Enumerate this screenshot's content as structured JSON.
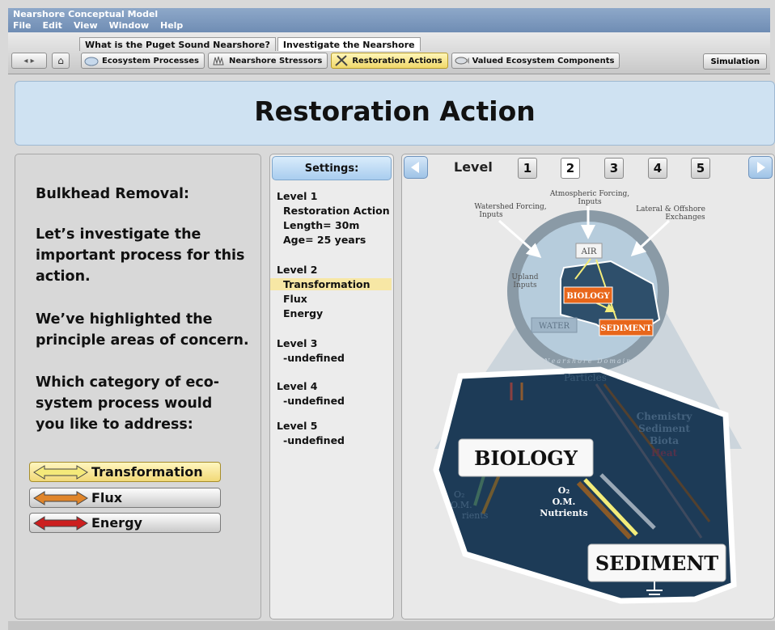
{
  "app": {
    "title": "Nearshore Conceptual Model"
  },
  "menu": [
    "File",
    "Edit",
    "View",
    "Window",
    "Help"
  ],
  "tabs": [
    {
      "label": "What is the Puget Sound Nearshore?"
    },
    {
      "label": "Investigate the Nearshore"
    }
  ],
  "subtabs": [
    {
      "label": "Ecosystem Processes",
      "icon": "ecosystem-icon"
    },
    {
      "label": "Nearshore Stressors",
      "icon": "hand-icon"
    },
    {
      "label": "Restoration Actions",
      "icon": "tools-icon"
    },
    {
      "label": "Valued Ecosystem Components",
      "icon": "fish-icon"
    }
  ],
  "toolbar": {
    "simulation": "Simulation"
  },
  "header": {
    "title": "Restoration Action"
  },
  "left": {
    "heading": "Bulkhead Removal:",
    "p1": [
      "Let’s investigate the",
      "important process for this",
      "action."
    ],
    "p2": [
      "We’ve highlighted the",
      "principle areas of concern."
    ],
    "p3": [
      "Which category of eco-",
      "system process would",
      "you like to address:"
    ],
    "buttons": [
      {
        "label": "Transformation",
        "color": "#f2e46a"
      },
      {
        "label": "Flux",
        "color": "#e0852a"
      },
      {
        "label": "Energy",
        "color": "#cc1f1f"
      }
    ]
  },
  "settings": {
    "header": "Settings:",
    "rows": [
      "Level 1",
      "Restoration Action",
      "Length= 30m",
      "Age= 25 years",
      "Level 2",
      "Transformation",
      "Flux",
      "Energy",
      "Level 3",
      "-undefined",
      "Level 4",
      "-undefined",
      "Level 5",
      "-undefined"
    ]
  },
  "levels": {
    "label": "Level",
    "numbers": [
      "1",
      "2",
      "3",
      "4",
      "5"
    ],
    "active": "2"
  },
  "diagram": {
    "atmos": [
      "Atmospheric Forcing,",
      "Inputs"
    ],
    "watershed": [
      "Watershed Forcing,",
      "Inputs"
    ],
    "lateral": [
      "Lateral & Offshore",
      "Exchanges"
    ],
    "air": "AIR",
    "upland": [
      "Upland",
      "Inputs"
    ],
    "biology_small": "BIOLOGY",
    "water": "WATER",
    "sediment_small": "SEDIMENT",
    "domain": "Nearshore Domain",
    "particles": "Particles",
    "bigtext": [
      "Chemistry",
      "Sediment",
      "Biota",
      "Heat"
    ],
    "nutrients": [
      "O₂",
      "O.M.",
      "Nutrients"
    ],
    "left_faint": [
      "O₂",
      "O.M.",
      "rients"
    ],
    "biology": "BIOLOGY",
    "sediment": "SEDIMENT"
  }
}
